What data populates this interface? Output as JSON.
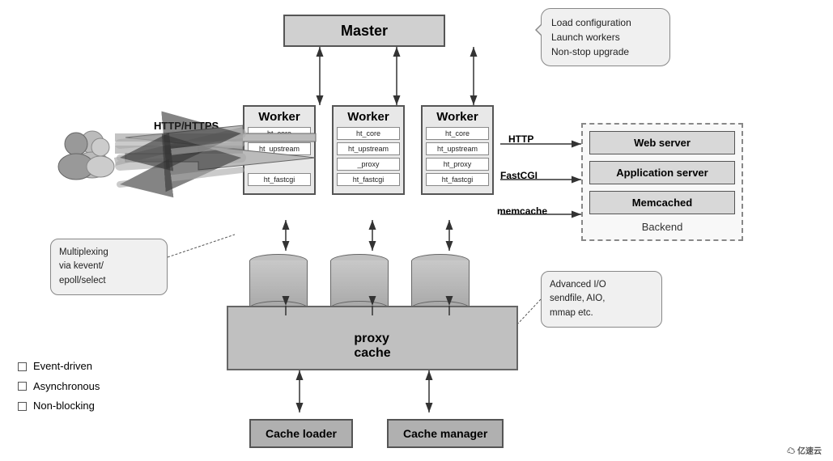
{
  "master": {
    "label": "Master"
  },
  "callout_top": {
    "line1": "Load configuration",
    "line2": "Launch workers",
    "line3": "Non-stop upgrade"
  },
  "workers": [
    {
      "title": "Worker",
      "modules": [
        "ht_core",
        "ht_upstream",
        "",
        "ht_fastcgi"
      ]
    },
    {
      "title": "Worker",
      "modules": [
        "ht_core",
        "ht_upstream",
        "_proxy",
        "ht_fastcgi"
      ]
    },
    {
      "title": "Worker",
      "modules": [
        "ht_core",
        "ht_upstream",
        "ht_proxy",
        "ht_fastcgi"
      ]
    }
  ],
  "http_label": "HTTP/HTTPS",
  "protocols": {
    "http": "HTTP",
    "fastcgi": "FastCGI",
    "memcache": "memcache"
  },
  "backend": {
    "title": "Backend",
    "boxes": [
      "Web server",
      "Application server",
      "Memcached"
    ]
  },
  "proxy_cache": {
    "label": "proxy\ncache"
  },
  "callout_multiplex": {
    "text": "Multiplexing\nvia kevent/\nepoll/select"
  },
  "callout_advancedio": {
    "text": "Advanced I/O\nsendfile, AIO,\nmmap etc."
  },
  "cache_loader": "Cache loader",
  "cache_manager": "Cache manager",
  "legend": {
    "items": [
      "Event-driven",
      "Asynchronous",
      "Non-blocking"
    ]
  },
  "watermark": "亿速云"
}
